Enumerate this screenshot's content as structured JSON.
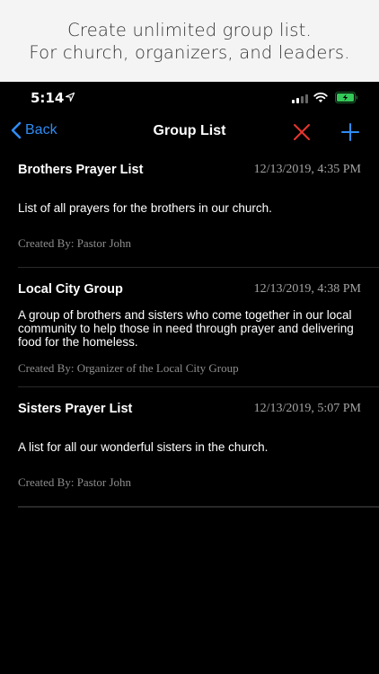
{
  "promo": {
    "line1": "Create unlimited group list.",
    "line2": "For church, organizers, and leaders."
  },
  "status_bar": {
    "time": "5:14",
    "icons": [
      "location-arrow-icon",
      "signal-icon",
      "wifi-icon",
      "battery-charging-icon"
    ],
    "battery_color": "#34c759"
  },
  "nav": {
    "back_label": "Back",
    "title": "Group List",
    "close_icon": "x-icon",
    "add_icon": "plus-icon",
    "accent_color": "#2f8cf5",
    "close_color": "#e8362f"
  },
  "groups": [
    {
      "name": "Brothers Prayer List",
      "date": "12/13/2019, 4:35 PM",
      "description": "List of all prayers for the brothers in our church.",
      "created_by": "Created By: Pastor John"
    },
    {
      "name": "Local City Group",
      "date": "12/13/2019, 4:38 PM",
      "description": "A group of brothers and sisters who come together in our local community to help those in need through prayer and delivering food for the homeless.",
      "created_by": "Created By: Organizer of the Local City Group"
    },
    {
      "name": "Sisters Prayer List",
      "date": "12/13/2019, 5:07 PM",
      "description": "A list for all our wonderful sisters in the church.",
      "created_by": "Created By: Pastor John"
    }
  ]
}
